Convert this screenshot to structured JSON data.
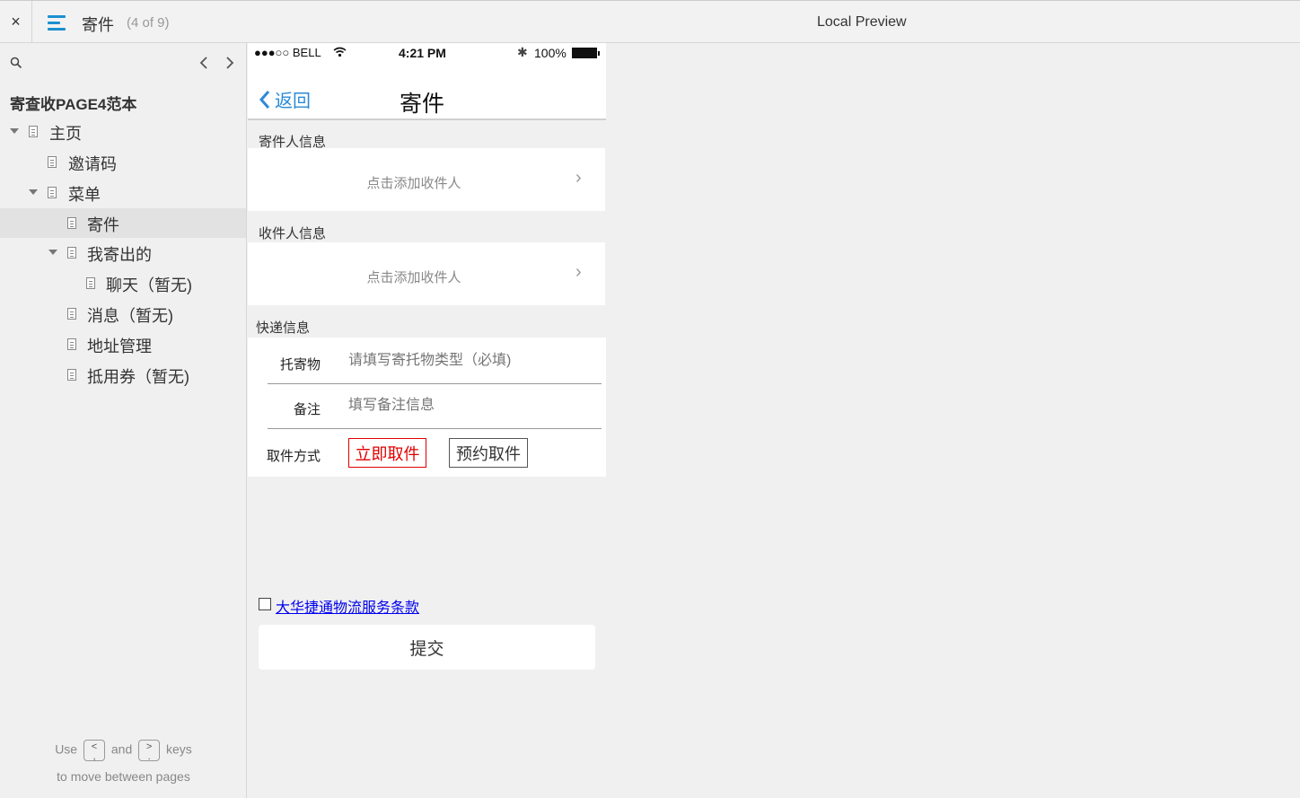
{
  "topbar": {
    "close_icon": "×",
    "page_title": "寄件",
    "page_count": "(4 of 9)",
    "preview_label": "Local Preview"
  },
  "sidebar": {
    "prev_icon": "‹",
    "next_icon": "›",
    "project_title": "寄查收PAGE4范本",
    "items": [
      {
        "label": "主页",
        "expandable": true
      },
      {
        "label": "邀请码"
      },
      {
        "label": "菜单",
        "expandable": true
      },
      {
        "label": "寄件",
        "selected": true
      },
      {
        "label": "我寄出的",
        "expandable": true
      },
      {
        "label": "聊天（暂无)"
      },
      {
        "label": "消息（暂无)"
      },
      {
        "label": "地址管理"
      },
      {
        "label": "抵用券（暂无)"
      }
    ],
    "hint_use": "Use",
    "hint_and": "and",
    "hint_keys": "keys",
    "hint_line2": "to move between pages",
    "key_prev": "<",
    "key_prev_sub": ",",
    "key_next": ">",
    "key_next_sub": "."
  },
  "phone": {
    "status": {
      "signal": "●●●○○ BELL",
      "wifi_icon": "wifi-icon",
      "time": "4:21 PM",
      "bluetooth": "✱",
      "battery": "100%"
    },
    "nav": {
      "back_label": "返回",
      "back_chevron": "‹",
      "title": "寄件"
    },
    "sender": {
      "section_label": "寄件人信息",
      "add_text": "点击添加收件人",
      "chevron": "›"
    },
    "recipient": {
      "section_label": "收件人信息",
      "add_text": "点击添加收件人",
      "chevron": "›"
    },
    "express": {
      "section_label": "快递信息",
      "item_label": "托寄物",
      "item_placeholder": "请填写寄托物类型（必填)",
      "note_label": "备注",
      "note_placeholder": "填写备注信息",
      "pickup_label": "取件方式",
      "pickup_now": "立即取件",
      "pickup_later": "预约取件"
    },
    "terms_link": "大华捷通物流服务条款",
    "submit_label": "提交"
  },
  "colors": {
    "accent": "#2b8ad8",
    "menu_icon": "#1b8fd0",
    "pickup_now": "#e00000",
    "link": "#0000ee"
  }
}
